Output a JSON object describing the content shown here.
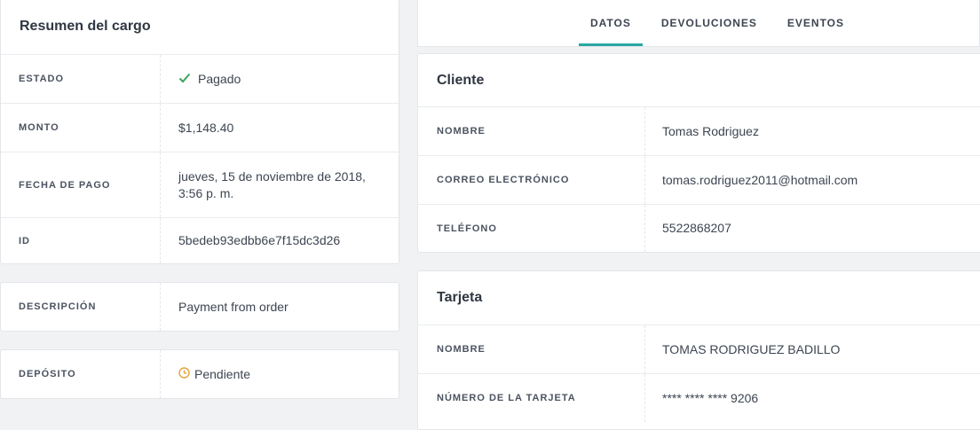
{
  "summary": {
    "title": "Resumen del cargo",
    "rows": [
      {
        "label": "ESTADO",
        "value": "Pagado"
      },
      {
        "label": "MONTO",
        "value": "$1,148.40"
      },
      {
        "label": "FECHA DE PAGO",
        "value_line1": "jueves, 15 de noviembre de 2018,",
        "value_line2": "3:56 p. m."
      },
      {
        "label": "ID",
        "value": "5bedeb93edbb6e7f15dc3d26"
      }
    ]
  },
  "description": {
    "label": "DESCRIPCIÓN",
    "value": "Payment from order"
  },
  "deposit": {
    "label": "DEPÓSITO",
    "value": "Pendiente"
  },
  "tabs": [
    {
      "label": "DATOS",
      "active": true
    },
    {
      "label": "DEVOLUCIONES",
      "active": false
    },
    {
      "label": "EVENTOS",
      "active": false
    }
  ],
  "client": {
    "title": "Cliente",
    "rows": [
      {
        "label": "NOMBRE",
        "value": "Tomas Rodriguez"
      },
      {
        "label": "CORREO ELECTRÓNICO",
        "value": "tomas.rodriguez2011@hotmail.com"
      },
      {
        "label": "TELÉFONO",
        "value": "5522868207"
      }
    ]
  },
  "card": {
    "title": "Tarjeta",
    "rows": [
      {
        "label": "NOMBRE",
        "value": "TOMAS RODRIGUEZ BADILLO"
      },
      {
        "label": "NÚMERO DE LA TARJETA",
        "value": "**** **** **** 9206"
      }
    ]
  },
  "colors": {
    "accent": "#2aa8a4",
    "paid": "#3aa55a",
    "pending": "#e8a23a"
  },
  "icons": {
    "paid": "check-icon",
    "pending": "clock-icon"
  }
}
